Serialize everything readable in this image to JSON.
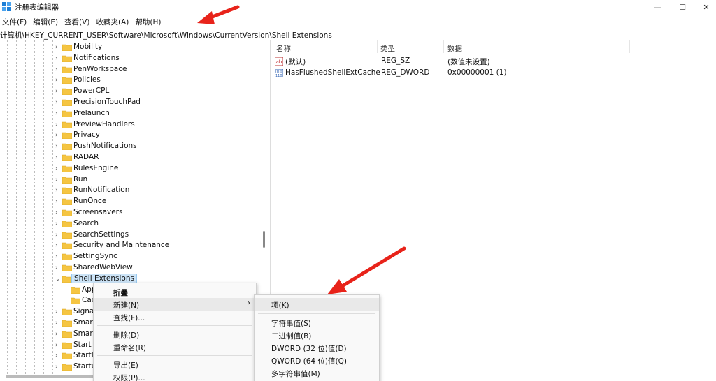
{
  "window": {
    "title": "注册表编辑器",
    "minimize": "—",
    "maximize": "☐",
    "close": "✕"
  },
  "menubar": [
    "文件(F)",
    "编辑(E)",
    "查看(V)",
    "收藏夹(A)",
    "帮助(H)"
  ],
  "address": "计算机\\HKEY_CURRENT_USER\\Software\\Microsoft\\Windows\\CurrentVersion\\Shell Extensions",
  "tree": {
    "items": [
      "Mobility",
      "Notifications",
      "PenWorkspace",
      "Policies",
      "PowerCPL",
      "PrecisionTouchPad",
      "Prelaunch",
      "PreviewHandlers",
      "Privacy",
      "PushNotifications",
      "RADAR",
      "RulesEngine",
      "Run",
      "RunNotification",
      "RunOnce",
      "Screensavers",
      "Search",
      "SearchSettings",
      "Security and Maintenance",
      "SettingSync",
      "SharedWebView",
      "Shell Extensions"
    ],
    "selected": "Shell Extensions",
    "children": [
      "App",
      "Cac"
    ],
    "after": [
      "Signal",
      "Smart",
      "Smart",
      "Start",
      "StartL",
      "Startu"
    ]
  },
  "values": {
    "headers": {
      "name": "名称",
      "type": "类型",
      "data": "数据"
    },
    "rows": [
      {
        "icon": "string-value-icon",
        "name": "(默认)",
        "type": "REG_SZ",
        "data": "(数值未设置)"
      },
      {
        "icon": "binary-value-icon",
        "name": "HasFlushedShellExtCache",
        "type": "REG_DWORD",
        "data": "0x00000001 (1)"
      }
    ]
  },
  "context_menu": {
    "collapse": "折叠",
    "new": "新建(N)",
    "find": "查找(F)...",
    "delete": "删除(D)",
    "rename": "重命名(R)",
    "export": "导出(E)",
    "permissions": "权限(P)..."
  },
  "new_submenu": {
    "key": "项(K)",
    "string": "字符串值(S)",
    "binary": "二进制值(B)",
    "dword": "DWORD (32 位)值(D)",
    "qword": "QWORD (64 位)值(Q)",
    "multi": "多字符串值(M)"
  },
  "colors": {
    "selection": "#cce4f7",
    "annotation_arrow": "#e8231a",
    "folder": "#f5c542"
  }
}
